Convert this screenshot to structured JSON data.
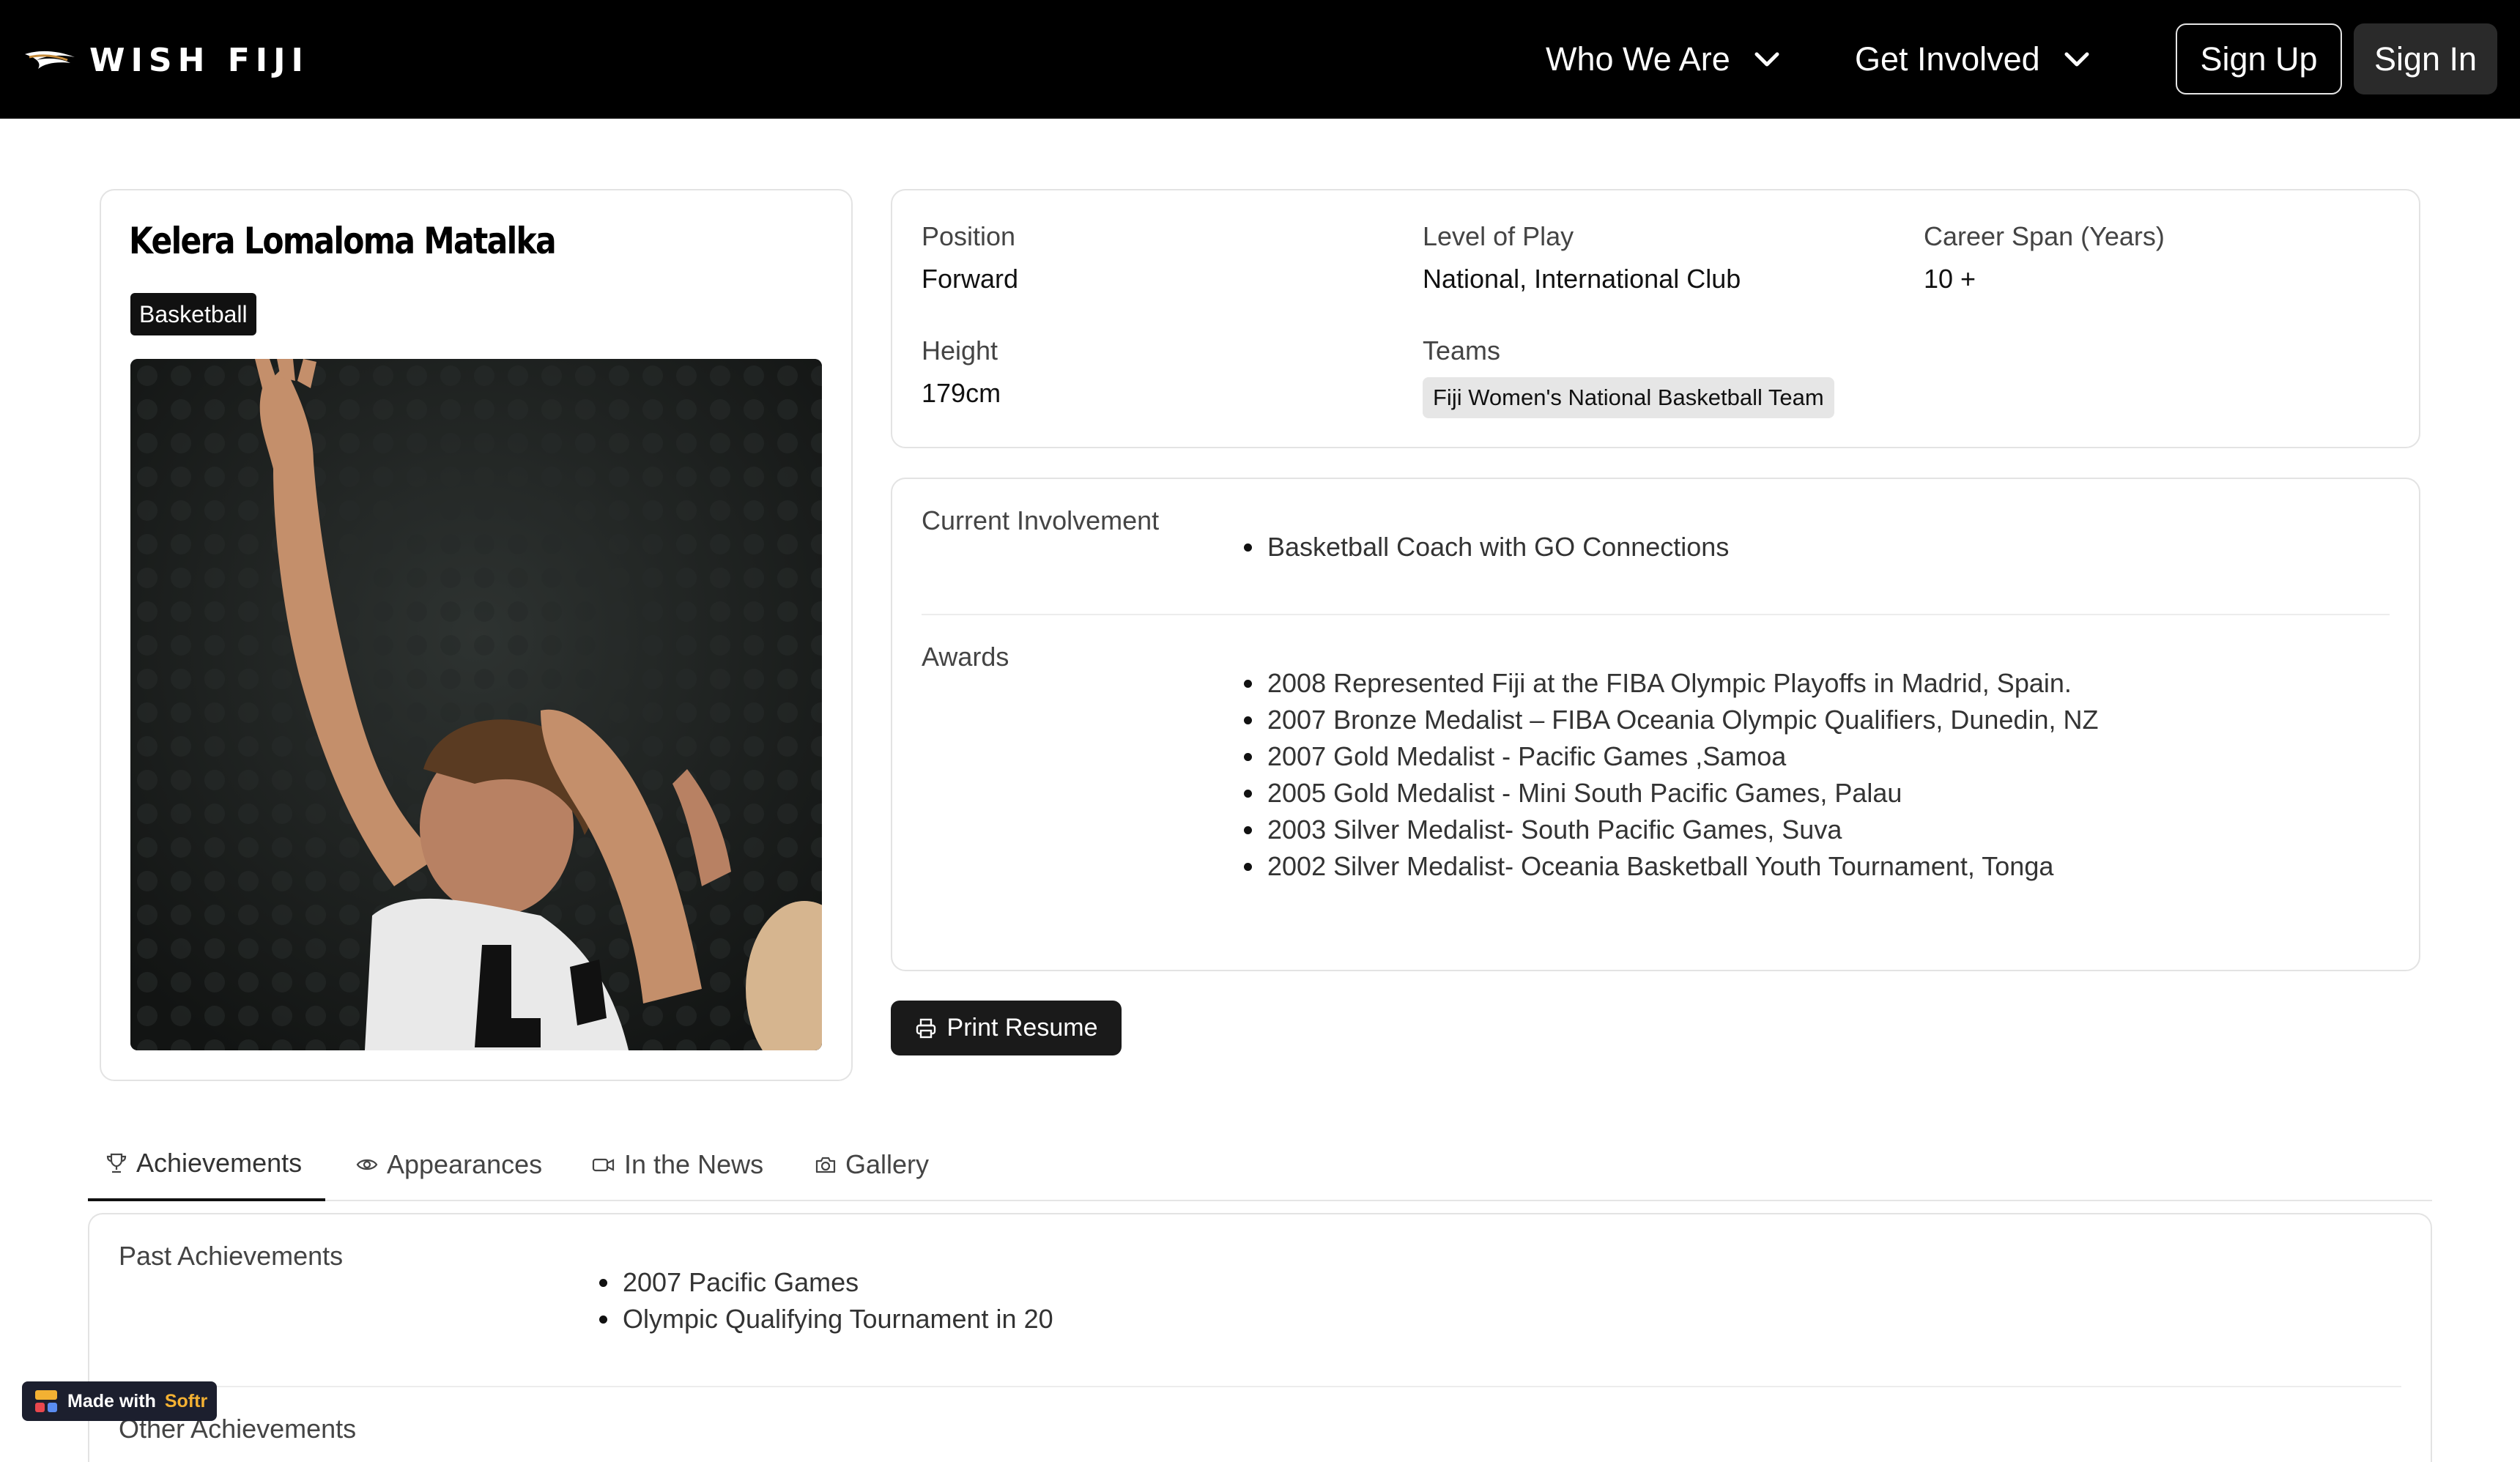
{
  "header": {
    "brand": "WISH FIJI",
    "nav": [
      {
        "label": "Who We Are"
      },
      {
        "label": "Get Involved"
      }
    ],
    "sign_up": "Sign Up",
    "sign_in": "Sign In"
  },
  "profile": {
    "name": "Kelera Lomaloma Matalka",
    "sport": "Basketball"
  },
  "details": {
    "position_label": "Position",
    "position_value": "Forward",
    "level_label": "Level of Play",
    "level_value": "National, International Club",
    "career_label": "Career Span (Years)",
    "career_value": "10 +",
    "height_label": "Height",
    "height_value": "179cm",
    "teams_label": "Teams",
    "teams": [
      "Fiji Women's National Basketball Team"
    ]
  },
  "involvement": {
    "label": "Current Involvement",
    "items": [
      "Basketball Coach with GO Connections"
    ]
  },
  "awards": {
    "label": "Awards",
    "items": [
      "2008 Represented Fiji at the FIBA Olympic Playoffs in Madrid, Spain.",
      "2007 Bronze Medalist – FIBA Oceania Olympic Qualifiers, Dunedin, NZ",
      "2007 Gold Medalist - Pacific Games ,Samoa",
      "2005 Gold Medalist - Mini South Pacific Games, Palau",
      "2003 Silver Medalist- South Pacific Games, Suva",
      "2002 Silver Medalist- Oceania Basketball Youth Tournament, Tonga"
    ]
  },
  "print_label": "Print Resume",
  "tabs": [
    {
      "label": "Achievements",
      "icon": "trophy-icon"
    },
    {
      "label": "Appearances",
      "icon": "eye-icon"
    },
    {
      "label": "In the News",
      "icon": "video-icon"
    },
    {
      "label": "Gallery",
      "icon": "camera-icon"
    }
  ],
  "achievements": {
    "past_label": "Past Achievements",
    "past_items": [
      "2007 Pacific Games",
      "Olympic Qualifying Tournament in 20"
    ],
    "other_label": "Other Achievements"
  },
  "softr_badge": {
    "prefix": "Made with",
    "brand": "Softr"
  }
}
